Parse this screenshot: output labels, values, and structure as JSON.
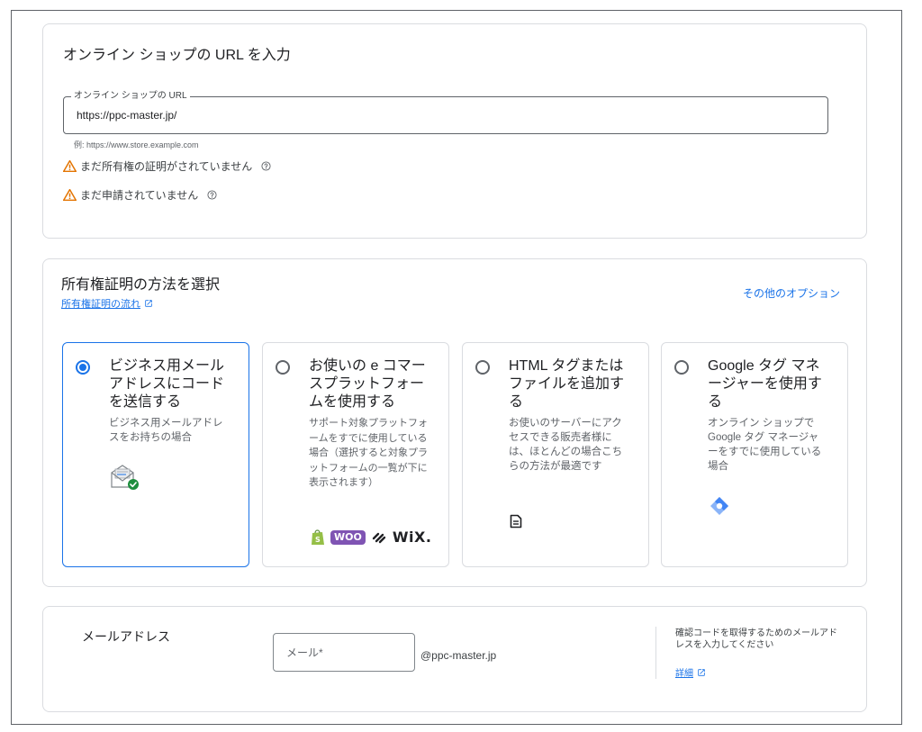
{
  "url_section": {
    "title": "オンライン ショップの URL を入力",
    "field_label": "オンライン ショップの URL",
    "field_value": "https://ppc-master.jp/",
    "hint": "例: https://www.store.example.com",
    "warnings": [
      "まだ所有権の証明がされていません",
      "まだ申請されていません"
    ]
  },
  "verification": {
    "title": "所有権証明の方法を選択",
    "flow_link": "所有権証明の流れ",
    "other_options": "その他のオプション",
    "options": [
      {
        "title": "ビジネス用メールアドレスにコードを送信する",
        "description": "ビジネス用メールアドレスをお持ちの場合",
        "selected": true,
        "icon": "mail-check-icon"
      },
      {
        "title": "お使いの e コマースプラットフォームを使用する",
        "description": "サポート対象プラットフォームをすでに使用している場合（選択すると対象プラットフォームの一覧が下に表示されます）",
        "selected": false,
        "icon": "platform-logos",
        "logos": [
          "Shopify",
          "WOO",
          "Squarespace",
          "WiX."
        ]
      },
      {
        "title": "HTML タグまたはファイルを追加する",
        "description": "お使いのサーバーにアクセスできる販売者様には、ほとんどの場合こちらの方法が最適です",
        "selected": false,
        "icon": "file-icon"
      },
      {
        "title": "Google タグ マネージャーを使用する",
        "description": "オンライン ショップで Google タグ マネージャーをすでに使用している場合",
        "selected": false,
        "icon": "gtm-icon"
      }
    ]
  },
  "email_section": {
    "label": "メールアドレス",
    "input_placeholder": "メール*",
    "domain_suffix": "@ppc-master.jp",
    "help_text": "確認コードを取得するためのメールアドレスを入力してください",
    "details_link": "詳細"
  },
  "colors": {
    "accent": "#1a73e8",
    "warning": "#e37400",
    "border": "#dadce0",
    "check_green": "#1e8e3e"
  }
}
